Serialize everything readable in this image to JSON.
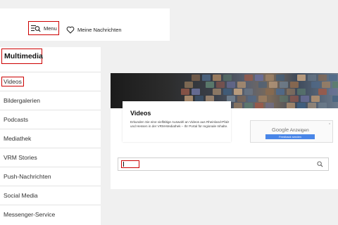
{
  "header": {
    "menu_label": "Menu",
    "my_news_label": "Meine Nachrichten"
  },
  "sidebar": {
    "title": "Multimedia",
    "items": [
      {
        "label": "Videos",
        "active": true
      },
      {
        "label": "Bildergalerien"
      },
      {
        "label": "Podcasts"
      },
      {
        "label": "Mediathek"
      },
      {
        "label": "VRM Stories"
      },
      {
        "label": "Push-Nachrichten"
      },
      {
        "label": "Social Media"
      },
      {
        "label": "Messenger-Service"
      }
    ]
  },
  "content": {
    "title": "Videos",
    "description": "Erkunden Sie eine vielfältige Auswahl an Videos aus Rheinland-Pfalz und Hessen in der VRM-Mediathek – Ihr Portal für regionale Inhalte."
  },
  "ad": {
    "brand": "Google",
    "label": "Anzeigen",
    "feedback": "Feedback senden",
    "close": "x"
  },
  "search": {
    "value": "",
    "placeholder": ""
  },
  "colors": {
    "highlight": "#cc0000",
    "ad_button": "#4a86e8"
  },
  "icons": {
    "menu": "menu-search-icon",
    "my_news": "heart-icon",
    "search": "magnifier-icon"
  }
}
